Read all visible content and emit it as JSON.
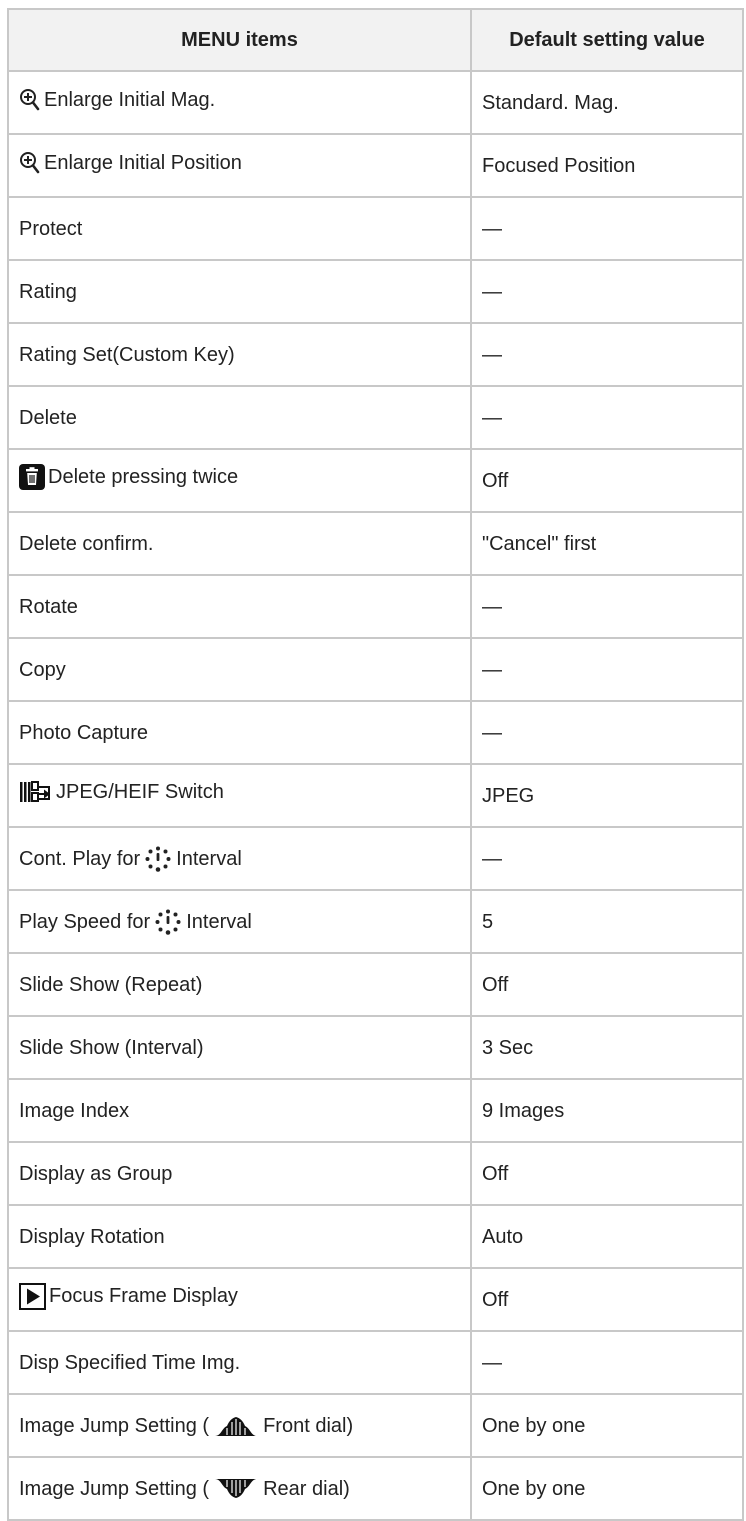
{
  "table": {
    "headers": [
      "MENU items",
      "Default setting value"
    ],
    "rows": [
      {
        "icon": "magnify-plus-icon",
        "prefix": "",
        "label": "Enlarge Initial Mag.",
        "suffix": "",
        "value": "Standard. Mag."
      },
      {
        "icon": "magnify-plus-icon",
        "prefix": "",
        "label": "Enlarge Initial Position",
        "suffix": "",
        "value": "Focused Position"
      },
      {
        "icon": "",
        "prefix": "",
        "label": "Protect",
        "suffix": "",
        "value": "—"
      },
      {
        "icon": "",
        "prefix": "",
        "label": "Rating",
        "suffix": "",
        "value": "—"
      },
      {
        "icon": "",
        "prefix": "",
        "label": "Rating Set(Custom Key)",
        "suffix": "",
        "value": "—"
      },
      {
        "icon": "",
        "prefix": "",
        "label": "Delete",
        "suffix": "",
        "value": "—"
      },
      {
        "icon": "trash-icon",
        "prefix": "",
        "label": "Delete pressing twice",
        "suffix": "",
        "value": "Off"
      },
      {
        "icon": "",
        "prefix": "",
        "label": "Delete confirm.",
        "suffix": "",
        "value": "\"Cancel\" first"
      },
      {
        "icon": "",
        "prefix": "",
        "label": "Rotate",
        "suffix": "",
        "value": "—"
      },
      {
        "icon": "",
        "prefix": "",
        "label": "Copy",
        "suffix": "",
        "value": "—"
      },
      {
        "icon": "",
        "prefix": "",
        "label": "Photo Capture",
        "suffix": "",
        "value": "—"
      },
      {
        "icon": "jpeg-heif-switch-icon",
        "prefix": "",
        "label": "JPEG/HEIF Switch",
        "suffix": "",
        "value": "JPEG"
      },
      {
        "icon": "interval-icon",
        "prefix": "Cont. Play for",
        "label": "",
        "suffix": "Interval",
        "value": "—"
      },
      {
        "icon": "interval-icon",
        "prefix": "Play Speed for",
        "label": "",
        "suffix": "Interval",
        "value": "5"
      },
      {
        "icon": "",
        "prefix": "",
        "label": "Slide Show (Repeat)",
        "suffix": "",
        "value": "Off"
      },
      {
        "icon": "",
        "prefix": "",
        "label": "Slide Show (Interval)",
        "suffix": "",
        "value": "3 Sec"
      },
      {
        "icon": "",
        "prefix": "",
        "label": "Image Index",
        "suffix": "",
        "value": "9 Images"
      },
      {
        "icon": "",
        "prefix": "",
        "label": "Display as Group",
        "suffix": "",
        "value": "Off"
      },
      {
        "icon": "",
        "prefix": "",
        "label": "Display Rotation",
        "suffix": "",
        "value": "Auto"
      },
      {
        "icon": "playback-icon",
        "prefix": "",
        "label": "Focus Frame Display",
        "suffix": "",
        "value": "Off"
      },
      {
        "icon": "",
        "prefix": "",
        "label": "Disp Specified Time Img.",
        "suffix": "",
        "value": "—"
      },
      {
        "icon": "front-dial-icon",
        "prefix": "Image Jump Setting (",
        "label": "",
        "suffix": "Front dial)",
        "value": "One by one"
      },
      {
        "icon": "rear-dial-icon",
        "prefix": "Image Jump Setting (",
        "label": "",
        "suffix": "Rear dial)",
        "value": "One by one"
      }
    ]
  }
}
